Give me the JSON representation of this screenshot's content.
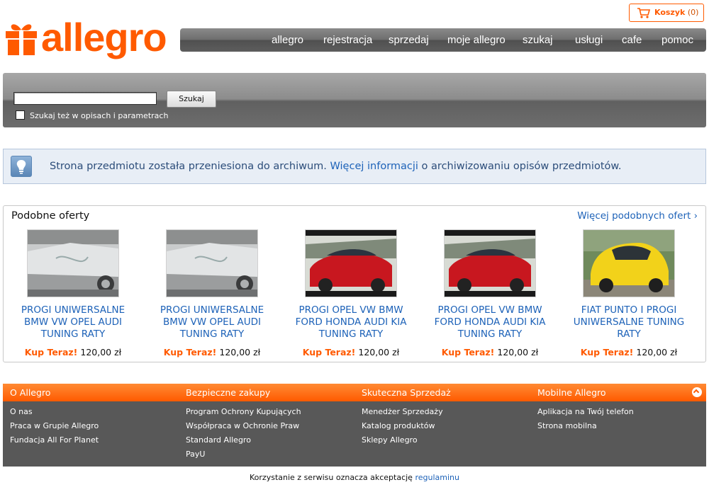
{
  "header": {
    "logo_text": "allegro",
    "cart": {
      "label": "Koszyk",
      "count": "(0)"
    },
    "nav": [
      "allegro",
      "rejestracja",
      "sprzedaj",
      "moje allegro",
      "szukaj",
      "usługi",
      "cafe",
      "pomoc"
    ]
  },
  "search": {
    "input_value": "",
    "button_label": "Szukaj",
    "checkbox_label": "Szukaj też w opisach i parametrach",
    "checkbox_checked": false
  },
  "info": {
    "text_before": "Strona przedmiotu została przeniesiona do archiwum. ",
    "link": "Więcej informacji",
    "text_after": " o archiwizowaniu opisów przedmiotów."
  },
  "offers": {
    "title": "Podobne oferty",
    "more_link": "Więcej podobnych ofert ›",
    "items": [
      {
        "title": "PROGI UNIWERSALNE BMW VW OPEL AUDI TUNING RATY",
        "buy_label": "Kup Teraz!",
        "price": "120,00 zł",
        "image": "silver-car-side"
      },
      {
        "title": "PROGI UNIWERSALNE BMW VW OPEL AUDI TUNING RATY",
        "buy_label": "Kup Teraz!",
        "price": "120,00 zł",
        "image": "silver-car-side"
      },
      {
        "title": "PROGI OPEL VW BMW FORD HONDA AUDI KIA TUNING RATY",
        "buy_label": "Kup Teraz!",
        "price": "120,00 zł",
        "image": "red-car-front"
      },
      {
        "title": "PROGI OPEL VW BMW FORD HONDA AUDI KIA TUNING RATY",
        "buy_label": "Kup Teraz!",
        "price": "120,00 zł",
        "image": "red-car-front"
      },
      {
        "title": "FIAT PUNTO I PROGI UNIWERSALNE TUNING RATY",
        "buy_label": "Kup Teraz!",
        "price": "120,00 zł",
        "image": "yellow-car"
      }
    ]
  },
  "footer": {
    "columns": [
      {
        "heading": "O Allegro",
        "links": [
          "O nas",
          "Praca w Grupie Allegro",
          "Fundacja All For Planet"
        ]
      },
      {
        "heading": "Bezpieczne zakupy",
        "links": [
          "Program Ochrony Kupujących",
          "Współpraca w Ochronie Praw",
          "Standard Allegro",
          "PayU"
        ]
      },
      {
        "heading": "Skuteczna Sprzedaż",
        "links": [
          "Menedżer Sprzedaży",
          "Katalog produktów",
          "Sklepy Allegro"
        ]
      },
      {
        "heading": "Mobilne Allegro",
        "links": [
          "Aplikacja na Twój telefon",
          "Strona mobilna"
        ]
      }
    ],
    "terms_text": "Korzystanie z serwisu oznacza akceptację ",
    "terms_link": "regulaminu"
  },
  "colors": {
    "brand": "#ff5a00",
    "link": "#1d62b8",
    "info_bg": "#e8eef6",
    "footer_bg": "#585858"
  }
}
